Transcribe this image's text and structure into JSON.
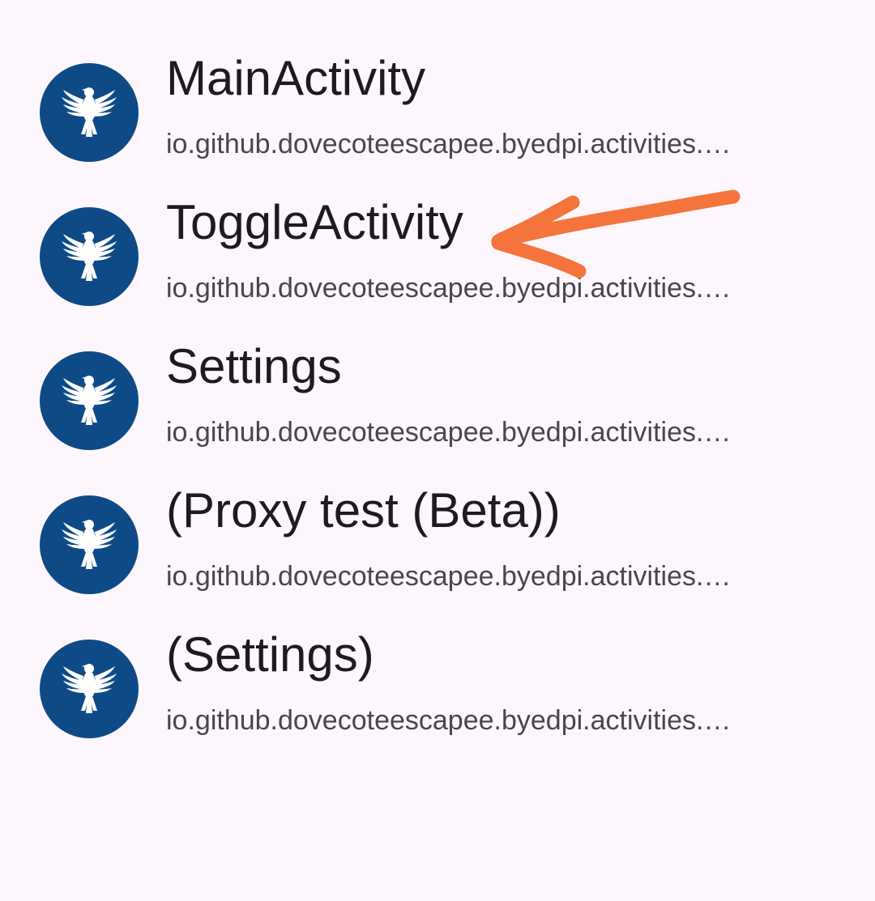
{
  "activities": [
    {
      "title": "MainActivity",
      "package": "io.github.dovecoteescapee.byedpi.activities.…",
      "icon": "byedpi-bird-icon"
    },
    {
      "title": "ToggleActivity",
      "package": "io.github.dovecoteescapee.byedpi.activities.…",
      "icon": "byedpi-bird-icon"
    },
    {
      "title": "Settings",
      "package": "io.github.dovecoteescapee.byedpi.activities.…",
      "icon": "byedpi-bird-icon"
    },
    {
      "title": "(Proxy test (Beta))",
      "package": "io.github.dovecoteescapee.byedpi.activities.…",
      "icon": "byedpi-bird-icon"
    },
    {
      "title": "(Settings)",
      "package": "io.github.dovecoteescapee.byedpi.activities.…",
      "icon": "byedpi-bird-icon"
    }
  ],
  "colors": {
    "background": "#fdf7fd",
    "icon_circle": "#0e4a86",
    "icon_bird": "#ffffff",
    "title_text": "#1c1a22",
    "subtitle_text": "#49454f",
    "annotation_arrow": "#f4743b"
  },
  "annotation": {
    "icon": "hand-drawn-arrow-icon",
    "points_to": "ToggleActivity"
  }
}
